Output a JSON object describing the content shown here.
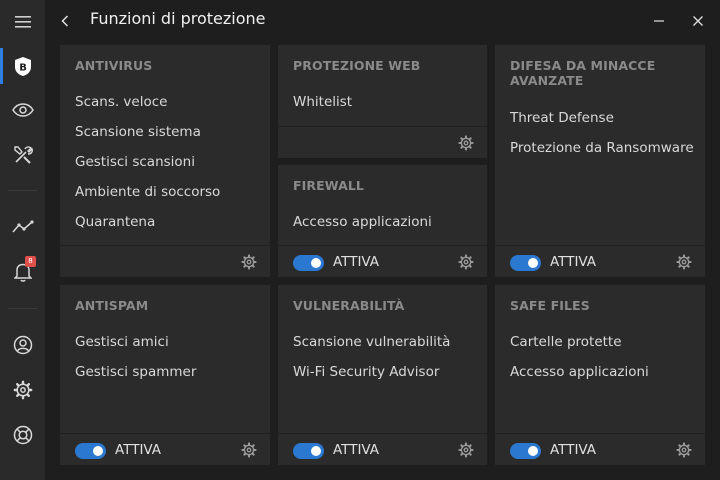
{
  "window": {
    "title": "Funzioni di protezione"
  },
  "sidebar": {
    "items": [
      {
        "icon": "menu-icon"
      },
      {
        "icon": "bitdefender-shield-icon",
        "label": "B"
      },
      {
        "icon": "eye-icon"
      },
      {
        "icon": "tools-icon"
      },
      {
        "icon": "activity-icon"
      },
      {
        "icon": "bell-icon",
        "badge": "8"
      },
      {
        "icon": "account-icon"
      },
      {
        "icon": "gear-icon"
      },
      {
        "icon": "lifebuoy-icon"
      }
    ]
  },
  "cards": {
    "antivirus": {
      "title": "ANTIVIRUS",
      "items": [
        "Scans. veloce",
        "Scansione sistema",
        "Gestisci scansioni",
        "Ambiente di soccorso",
        "Quarantena"
      ]
    },
    "web": {
      "title": "PROTEZIONE WEB",
      "items": [
        "Whitelist"
      ]
    },
    "firewall": {
      "title": "FIREWALL",
      "items": [
        "Accesso applicazioni"
      ],
      "toggle_label": "ATTIVA"
    },
    "atd": {
      "title": "DIFESA DA MINACCE AVANZATE",
      "items": [
        "Threat Defense",
        "Protezione da Ransomware"
      ],
      "toggle_label": "ATTIVA"
    },
    "antispam": {
      "title": "ANTISPAM",
      "items": [
        "Gestisci amici",
        "Gestisci spammer"
      ],
      "toggle_label": "ATTIVA"
    },
    "vuln": {
      "title": "VULNERABILITÀ",
      "items": [
        "Scansione vulnerabilità",
        "Wi-Fi Security Advisor"
      ],
      "toggle_label": "ATTIVA"
    },
    "safefiles": {
      "title": "SAFE FILES",
      "items": [
        "Cartelle protette",
        "Accesso applicazioni"
      ],
      "toggle_label": "ATTIVA"
    }
  },
  "colors": {
    "accent": "#2b78d0",
    "card_bg": "#2b2b2b",
    "app_bg": "#1e1e1e",
    "sidebar_bg": "#2a2a2a",
    "badge": "#e0504a"
  }
}
